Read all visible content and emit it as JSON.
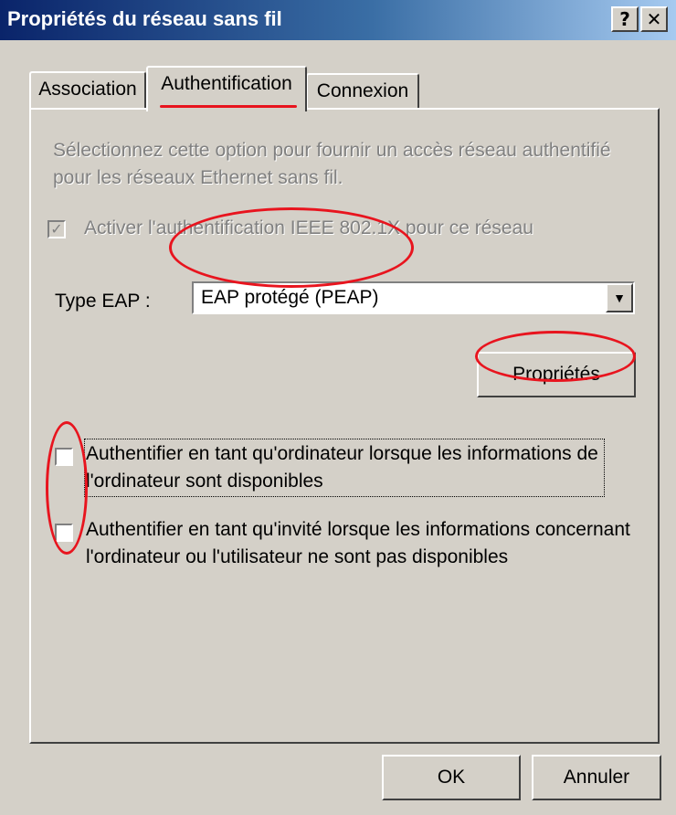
{
  "window": {
    "title": "Propriétés du réseau sans fil",
    "help_label": "?",
    "close_label": "✕"
  },
  "tabs": [
    {
      "label": "Association"
    },
    {
      "label": "Authentification"
    },
    {
      "label": "Connexion"
    }
  ],
  "auth": {
    "description": "Sélectionnez cette option pour fournir un accès réseau authentifié pour les réseaux Ethernet sans fil.",
    "enable_checkbox_label": "Activer l'authentification IEEE 802.1X pour ce réseau",
    "enable_checked_mark": "✓",
    "eap_type_label": "Type EAP :",
    "eap_type_value": "EAP protégé (PEAP)",
    "properties_button": "Propriétés",
    "option_computer": "Authentifier en tant qu'ordinateur lorsque les informations de l'ordinateur sont disponibles",
    "option_guest": "Authentifier en tant qu'invité lorsque les informations concernant l'ordinateur ou l'utilisateur ne sont pas disponibles"
  },
  "buttons": {
    "ok": "OK",
    "cancel": "Annuler"
  },
  "colors": {
    "titlebar_start": "#0a246a",
    "titlebar_end": "#a6caf0",
    "highlight_annotation": "#e8141e"
  }
}
